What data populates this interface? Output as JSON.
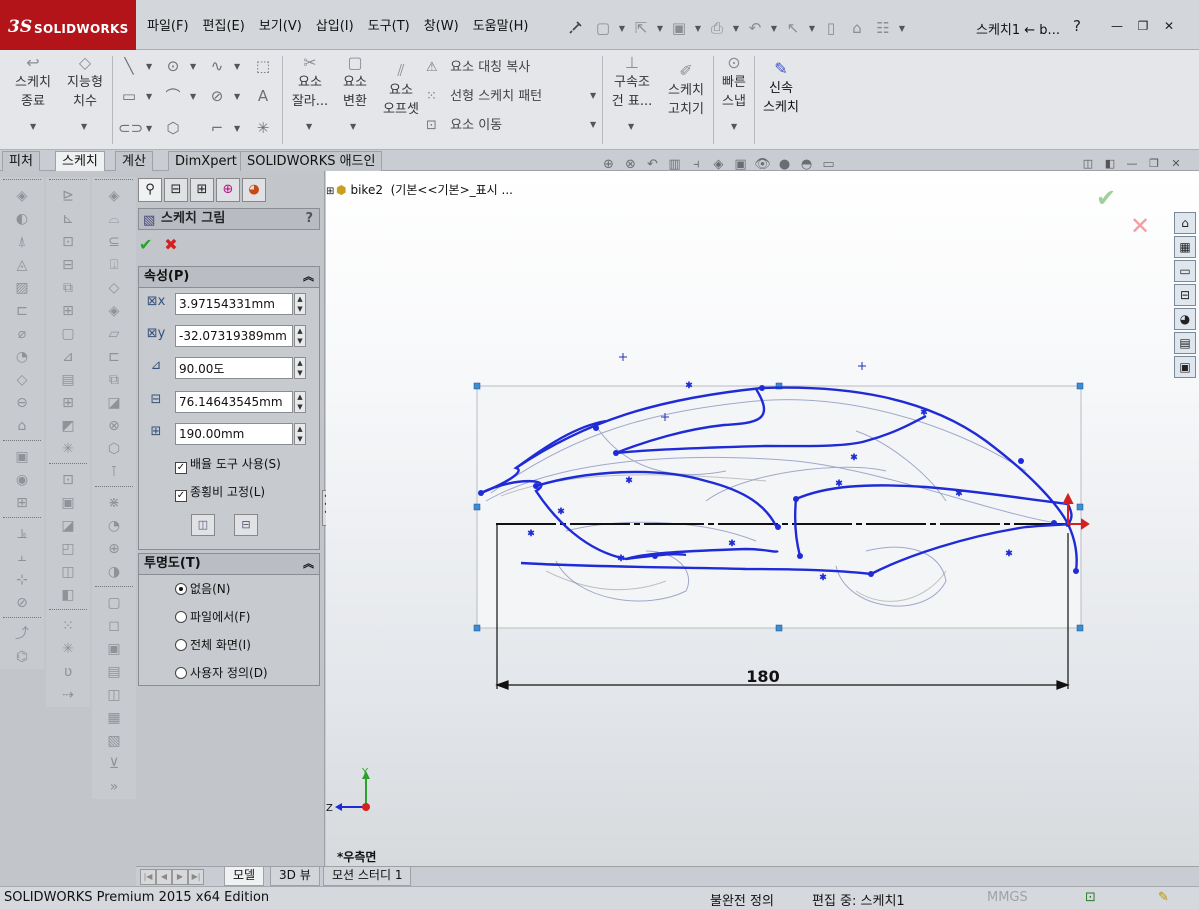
{
  "app": {
    "logo_ds": "3S",
    "logo_name": "SOLIDWORKS",
    "menu": [
      "파일(F)",
      "편집(E)",
      "보기(V)",
      "삽입(I)",
      "도구(T)",
      "창(W)",
      "도움말(H)"
    ],
    "document_title": "스케치1 ← b...",
    "help_symbol": "?"
  },
  "ribbon": {
    "sketch_exit": "스케치\n종료",
    "smart_dim": "지능형\n치수",
    "trim": "요소\n잘라...",
    "convert": "요소\n변환",
    "offset": "요소\n오프셋",
    "mirror": "요소 대칭 복사",
    "linear_pattern": "선형 스케치 패턴",
    "move": "요소 이동",
    "relations": "구속조\n건 표...",
    "repair": "스케치\n고치기",
    "quick_snap": "빠른\n스냅",
    "rapid_sketch": "신속\n스케치"
  },
  "tabs": [
    "피처",
    "스케치",
    "계산",
    "DimXpert",
    "SOLIDWORKS 애드인"
  ],
  "active_tab": "스케치",
  "tree": {
    "part_name": "bike2",
    "config": "(기본<<기본>_표시 ..."
  },
  "pm": {
    "title": "스케치 그림",
    "help": "?",
    "properties_header": "속성(P)",
    "x_value": "3.97154331mm",
    "y_value": "-32.07319389mm",
    "angle_value": "90.00도",
    "width_value": "76.14643545mm",
    "height_value": "190.00mm",
    "enable_scale_tool": "배율 도구 사용(S)",
    "lock_aspect": "종횡비 고정(L)",
    "transparency_header": "투명도(T)",
    "radio_none": "없음(N)",
    "radio_file": "파일에서(F)",
    "radio_full": "전체 화면(I)",
    "radio_user": "사용자 정의(D)",
    "selected_radio": "none"
  },
  "graphics": {
    "dimension": "180",
    "view_name": "*우측면",
    "triad_y": "Y",
    "triad_z": "Z"
  },
  "bottom_tabs": [
    "모델",
    "3D 뷰",
    "모션 스터디 1"
  ],
  "active_bottom_tab": "모델",
  "status": {
    "product": "SOLIDWORKS Premium 2015 x64 Edition",
    "state": "불완전 정의",
    "editing": "편집 중: 스케치1",
    "units": "MMGS"
  },
  "colors": {
    "brand_red": "#b3141a",
    "sketch_blue": "#1e2bd6",
    "ok_green": "#2aa12a",
    "cancel_red": "#d42020"
  }
}
